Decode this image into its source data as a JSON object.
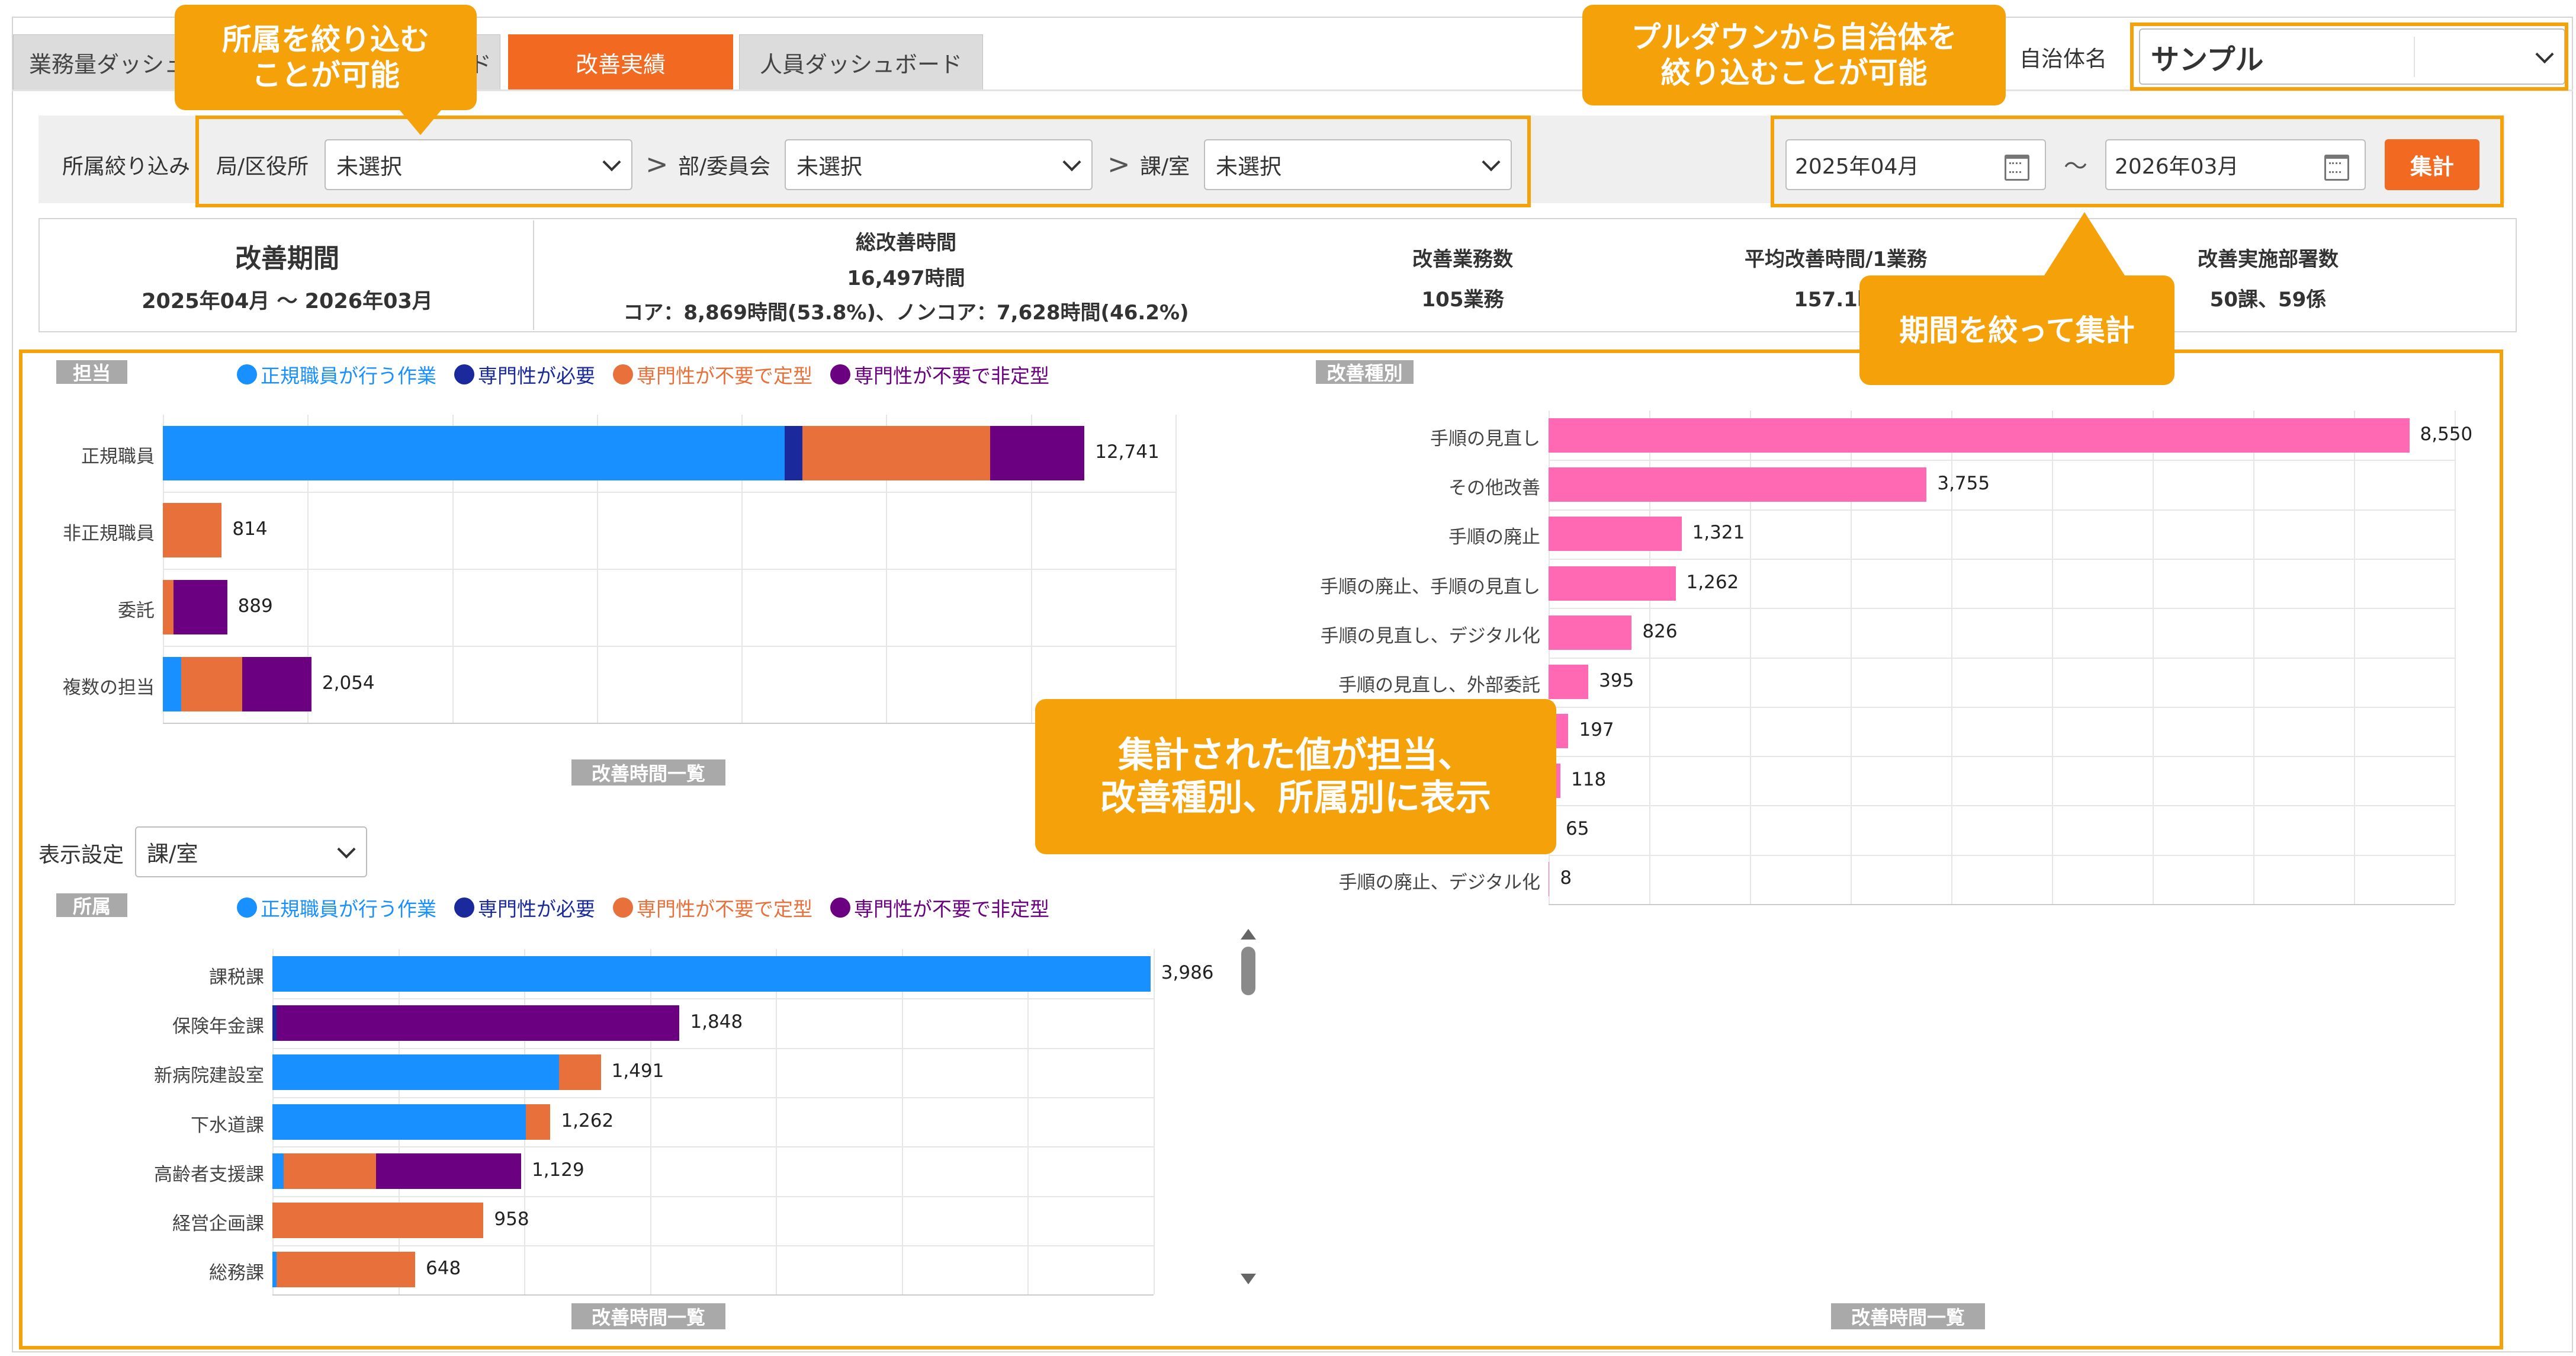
{
  "tabs": [
    {
      "label": "業務量ダッシュ"
    },
    {
      "label": "ボード"
    },
    {
      "label": "改善実績"
    },
    {
      "label": "人員ダッシュボード"
    }
  ],
  "municipality": {
    "label": "自治体名",
    "value": "サンプル"
  },
  "filter": {
    "title": "所属絞り込み",
    "bureau_label": "局/区役所",
    "bureau_value": "未選択",
    "dept_label": "部/委員会",
    "dept_value": "未選択",
    "section_label": "課/室",
    "section_value": "未選択",
    "sep": ">"
  },
  "period": {
    "from": "2025年04月",
    "tilde": "〜",
    "to": "2026年03月",
    "button": "集計"
  },
  "summary": {
    "period_title": "改善期間",
    "period_value": "2025年04月 〜 2026年03月",
    "total_title": "総改善時間",
    "total_value": "16,497時間",
    "total_breakdown": "コア：8,869時間(53.8%)、ノンコア：7,628時間(46.2%)",
    "count_title": "改善業務数",
    "count_value": "105業務",
    "avg_title": "平均改善時間/1業務",
    "avg_value": "157.1時",
    "depts_title": "改善実施部署数",
    "depts_value": "50課、59係"
  },
  "callouts": {
    "dept_filter": "所属を絞り込む\nことが可能",
    "muni_filter": "プルダウンから自治体を\n絞り込むことが可能",
    "period_filter": "期間を絞って集計",
    "display": "集計された値が担当、\n改善種別、所属別に表示"
  },
  "display_setting": {
    "label": "表示設定",
    "value": "課/室"
  },
  "buttons": {
    "list1": "改善時間一覧",
    "list2": "改善時間一覧",
    "list3": "改善時間一覧"
  },
  "colors": {
    "blue": "#1890ff",
    "navy": "#1a2a9c",
    "orange": "#e8703a",
    "purple": "#6b0080",
    "pink": "#ff69b4",
    "accent": "#f26a21",
    "callout": "#f5a20a"
  },
  "legend": [
    {
      "name": "正規職員が行う作業",
      "color": "#1890ff"
    },
    {
      "name": "専門性が必要",
      "color": "#1a2a9c"
    },
    {
      "name": "専門性が不要で定型",
      "color": "#e8703a"
    },
    {
      "name": "専門性が不要で非定型",
      "color": "#6b0080"
    }
  ],
  "chart_data": [
    {
      "type": "bar",
      "title": "担当",
      "orientation": "horizontal",
      "stacked": true,
      "categories": [
        "正規職員",
        "非正規職員",
        "委託",
        "複数の担当"
      ],
      "series": [
        {
          "name": "正規職員が行う作業",
          "values": [
            8600,
            0,
            0,
            250
          ]
        },
        {
          "name": "専門性が必要",
          "values": [
            240,
            0,
            0,
            0
          ]
        },
        {
          "name": "専門性が不要で定型",
          "values": [
            2600,
            814,
            150,
            850
          ]
        },
        {
          "name": "専門性が不要で非定型",
          "values": [
            1301,
            0,
            739,
            954
          ]
        }
      ],
      "totals": [
        "12,741",
        "814",
        "889",
        "2,054"
      ],
      "xlim": [
        0,
        14000
      ]
    },
    {
      "type": "bar",
      "title": "改善種別",
      "orientation": "horizontal",
      "categories": [
        "手順の見直し",
        "その他改善",
        "手順の廃止",
        "手順の廃止、手順の見直し",
        "手順の見直し、デジタル化",
        "手順の見直し、外部委託",
        "",
        "",
        "",
        "手順の廃止、デジタル化"
      ],
      "values": [
        8550,
        3755,
        1321,
        1262,
        826,
        395,
        197,
        118,
        65,
        8
      ],
      "labels": [
        "8,550",
        "3,755",
        "1,321",
        "1,262",
        "826",
        "395",
        "197",
        "118",
        "65",
        "8"
      ],
      "xlim": [
        0,
        9000
      ]
    },
    {
      "type": "bar",
      "title": "所属",
      "orientation": "horizontal",
      "stacked": true,
      "categories": [
        "課税課",
        "保険年金課",
        "新病院建設室",
        "下水道課",
        "高齢者支援課",
        "経営企画課",
        "総務課"
      ],
      "series": [
        {
          "name": "正規職員が行う作業",
          "values": [
            3986,
            0,
            1300,
            1150,
            50,
            0,
            20
          ]
        },
        {
          "name": "専門性が必要",
          "values": [
            0,
            20,
            0,
            0,
            0,
            0,
            0
          ]
        },
        {
          "name": "専門性が不要で定型",
          "values": [
            0,
            0,
            191,
            112,
            420,
            958,
            628
          ]
        },
        {
          "name": "専門性が不要で非定型",
          "values": [
            0,
            1828,
            0,
            0,
            659,
            0,
            0
          ]
        }
      ],
      "totals": [
        "3,986",
        "1,848",
        "1,491",
        "1,262",
        "1,129",
        "958",
        "648"
      ],
      "xlim": [
        0,
        4000
      ]
    }
  ]
}
